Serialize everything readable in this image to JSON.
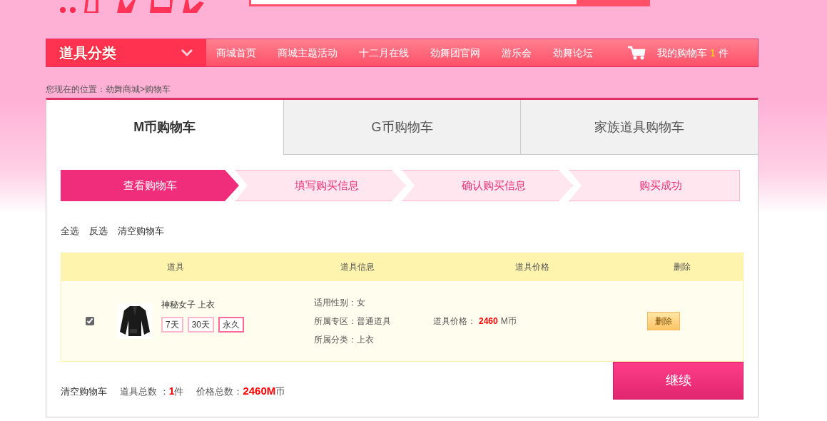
{
  "header": {
    "kind": "logo"
  },
  "nav": {
    "category": "道具分类",
    "links": [
      "商城首页",
      "商城主题活动",
      "十二月在线",
      "劲舞团官网",
      "游乐会",
      "劲舞论坛"
    ],
    "cart": {
      "label": "我的购物车",
      "count": "1",
      "unit": "件"
    }
  },
  "breadcrumb": "您现在的位置：劲舞商城>购物车",
  "tabs": [
    {
      "label": "M币购物车",
      "selected": true
    },
    {
      "label": "G币购物车",
      "selected": false
    },
    {
      "label": "家族道具购物车",
      "selected": false
    }
  ],
  "steps": [
    {
      "label": "查看购物车",
      "selected": true
    },
    {
      "label": "填写购买信息",
      "selected": false
    },
    {
      "label": "确认购买信息",
      "selected": false
    },
    {
      "label": "购买成功",
      "selected": false
    }
  ],
  "actions": [
    "全选",
    "反选",
    "清空购物车"
  ],
  "table": {
    "columns": [
      "道具",
      "道具信息",
      "道具价格",
      "删除"
    ],
    "rows": [
      {
        "checked": true,
        "kind": "picture",
        "name": "神秘女子 上衣",
        "durations": [
          {
            "label": "7天",
            "selected": false
          },
          {
            "label": "30天",
            "selected": false
          },
          {
            "label": "永久",
            "selected": true
          }
        ],
        "info": [
          "适用性别：女",
          "所属专区：普通道具",
          "所属分类：上衣"
        ],
        "price_label": "道具价格：",
        "price": "2460",
        "price_unit": "M币",
        "delete": "删除"
      }
    ]
  },
  "footer": {
    "clear": "清空购物车",
    "count_label": "道具总数 ：",
    "count": "1",
    "count_unit": "件",
    "total_label": "价格总数：",
    "total": "2460M",
    "total_unit": "币",
    "continue": "继续"
  }
}
